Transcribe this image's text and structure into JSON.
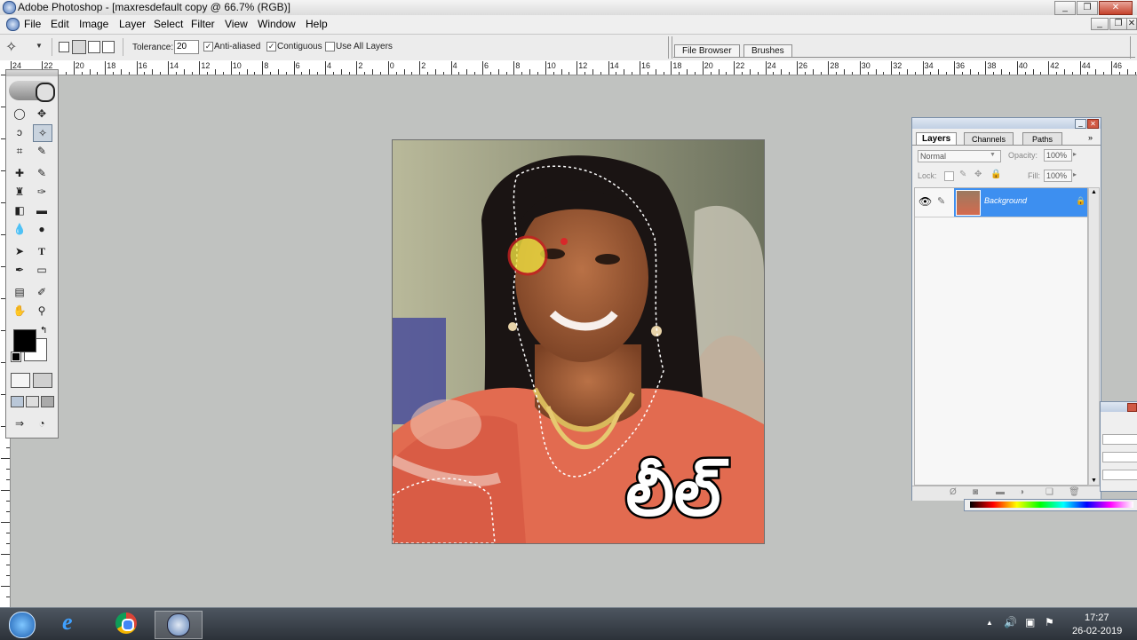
{
  "window": {
    "title": "Adobe Photoshop - [maxresdefault copy @ 66.7% (RGB)]"
  },
  "menu": [
    "File",
    "Edit",
    "Image",
    "Layer",
    "Select",
    "Filter",
    "View",
    "Window",
    "Help"
  ],
  "options": {
    "tolerance_label": "Tolerance:",
    "tolerance_value": "20",
    "anti_aliased_label": "Anti-aliased",
    "contiguous_label": "Contiguous",
    "use_all_layers_label": "Use All Layers",
    "palette_tabs": [
      "File Browser",
      "Brushes"
    ]
  },
  "ruler_labels": [
    "24",
    "22",
    "20",
    "18",
    "16",
    "14",
    "12",
    "10",
    "8",
    "6",
    "4",
    "2",
    "0",
    "2",
    "4",
    "6",
    "8",
    "10",
    "12",
    "14",
    "16",
    "18",
    "20",
    "22",
    "24",
    "26",
    "28",
    "30",
    "32",
    "34",
    "36",
    "38",
    "40",
    "42",
    "44",
    "46"
  ],
  "layers_panel": {
    "tabs": [
      "Layers",
      "Channels",
      "Paths"
    ],
    "blend_mode": "Normal",
    "opacity_label": "Opacity:",
    "opacity_value": "100%",
    "lock_label": "Lock:",
    "fill_label": "Fill:",
    "fill_value": "100%",
    "layer_name": "Background"
  },
  "canvas_overlay_text": "లీల్",
  "clock": {
    "time": "17:27",
    "date": "26-02-2019"
  },
  "colors": {
    "layer_selected": "#3d8ff0",
    "foreground": "#000000",
    "background": "#ffffff"
  }
}
